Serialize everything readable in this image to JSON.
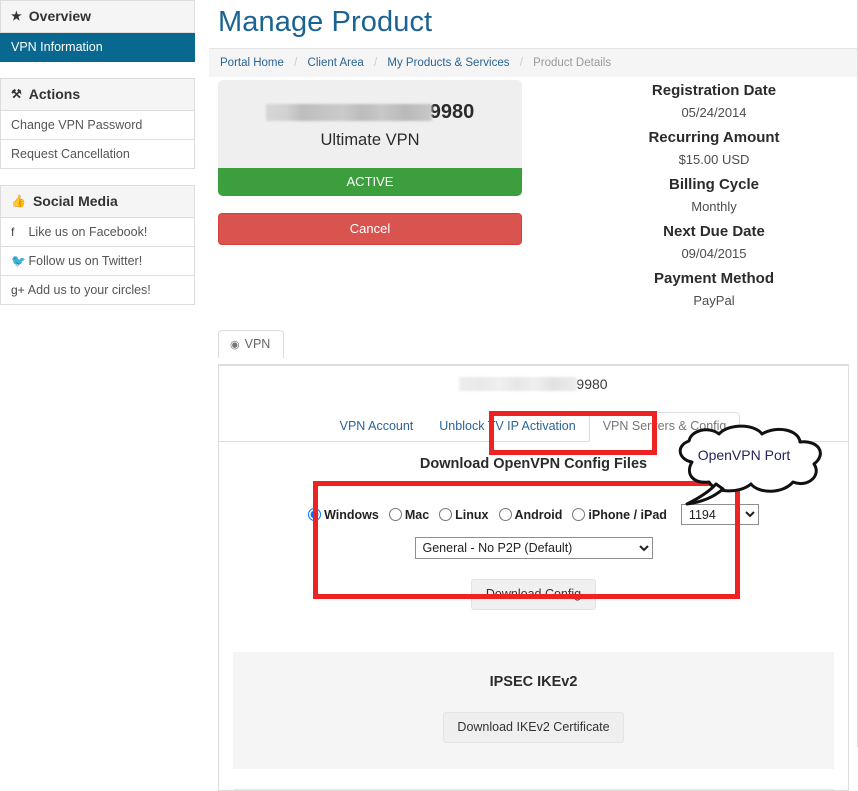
{
  "sidebar": {
    "sections": [
      {
        "title": "Overview",
        "icon": "star-icon",
        "icon_glyph": "★",
        "items": [
          {
            "label": "VPN Information",
            "active": true
          }
        ]
      },
      {
        "title": "Actions",
        "icon": "wrench-icon",
        "icon_glyph": "⚒",
        "items": [
          {
            "label": "Change VPN Password",
            "active": false
          },
          {
            "label": "Request Cancellation",
            "active": false
          }
        ]
      },
      {
        "title": "Social Media",
        "icon": "thumbs-up-icon",
        "icon_glyph": "👍",
        "items": [
          {
            "label": "Like us on Facebook!",
            "icon": "facebook-icon",
            "icon_glyph": "f",
            "active": false
          },
          {
            "label": "Follow us on Twitter!",
            "icon": "twitter-icon",
            "icon_glyph": "🐦",
            "active": false
          },
          {
            "label": "Add us to your circles!",
            "icon": "google-plus-icon",
            "icon_glyph": "g+",
            "active": false
          }
        ]
      }
    ],
    "active_color": "#08688f"
  },
  "header": {
    "title": "Manage Product",
    "title_color": "#1b6394"
  },
  "breadcrumb": {
    "items": [
      "Portal Home",
      "Client Area",
      "My Products & Services"
    ],
    "current": "Product Details",
    "separator": "/"
  },
  "product_card": {
    "account_suffix": "9980",
    "redacted": true,
    "name": "Ultimate VPN",
    "status": "ACTIVE",
    "status_color": "#3c9e3c",
    "cancel_label": "Cancel",
    "cancel_color": "#d9534f"
  },
  "details": [
    {
      "label": "Registration Date",
      "value": "05/24/2014"
    },
    {
      "label": "Recurring Amount",
      "value": "$15.00 USD"
    },
    {
      "label": "Billing Cycle",
      "value": "Monthly"
    },
    {
      "label": "Next Due Date",
      "value": "09/04/2015"
    },
    {
      "label": "Payment Method",
      "value": "PayPal"
    }
  ],
  "vpn_panel": {
    "tab_label": "VPN",
    "tab_icon": "globe-icon",
    "account_suffix": "9980",
    "inner_tabs": [
      {
        "label": "VPN Account",
        "active": false
      },
      {
        "label": "Unblock TV IP Activation",
        "active": false
      },
      {
        "label": "VPN Servers & Config",
        "active": true
      }
    ],
    "config_title": "Download OpenVPN Config Files",
    "platforms": [
      {
        "label": "Windows",
        "selected": true
      },
      {
        "label": "Mac",
        "selected": false
      },
      {
        "label": "Linux",
        "selected": false
      },
      {
        "label": "Android",
        "selected": false
      },
      {
        "label": "iPhone / iPad",
        "selected": false
      }
    ],
    "port": {
      "value": "1194",
      "options": [
        "1194"
      ]
    },
    "profile": {
      "value": "General - No P2P (Default)",
      "options": [
        "General - No P2P (Default)"
      ]
    },
    "download_config_label": "Download Config",
    "ipsec_title": "IPSEC IKEv2",
    "ipsec_button_label": "Download IKEv2 Certificate"
  },
  "annotations": {
    "color": "#ee2222",
    "callout_text": "OpenVPN Port",
    "boxes": [
      "vpn-servers-config-tab",
      "openvpn-config-form"
    ]
  }
}
